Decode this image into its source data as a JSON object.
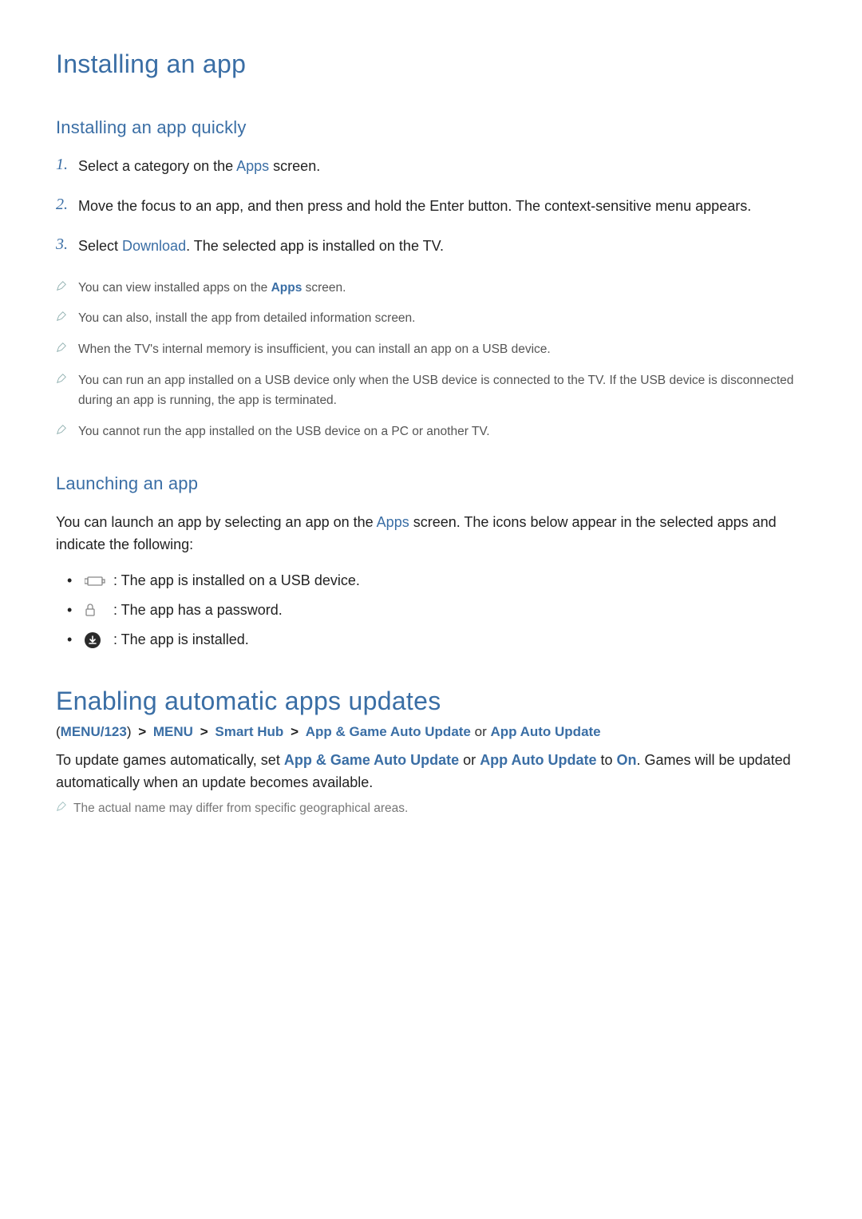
{
  "section1": {
    "title": "Installing an app",
    "sub1": {
      "heading": "Installing an app quickly",
      "steps": {
        "s1_num": "1.",
        "s1_a": "Select a category on the ",
        "s1_link": "Apps",
        "s1_b": " screen.",
        "s2_num": "2.",
        "s2": "Move the focus to an app, and then press and hold the Enter button. The context-sensitive menu appears.",
        "s3_num": "3.",
        "s3_a": "Select ",
        "s3_link": "Download",
        "s3_b": ". The selected app is installed on the TV."
      },
      "notes": {
        "n1_a": "You can view installed apps on the ",
        "n1_link": "Apps",
        "n1_b": " screen.",
        "n2": "You can also, install the app from detailed information screen.",
        "n3": "When the TV's internal memory is insufficient, you can install an app on a USB device.",
        "n4": "You can run an app installed on a USB device only when the USB device is connected to the TV. If the USB device is disconnected during an app is running, the app is terminated.",
        "n5": "You cannot run the app installed on the USB device on a PC or another TV."
      }
    },
    "sub2": {
      "heading": "Launching an app",
      "intro_a": "You can launch an app by selecting an app on the ",
      "intro_link": "Apps",
      "intro_b": " screen. The icons below appear in the selected apps and indicate the following:",
      "bullets": {
        "b1": " : The app is installed on a USB device.",
        "b2": " : The app has a password.",
        "b3": " : The app is installed."
      }
    }
  },
  "section2": {
    "title": "Enabling automatic apps updates",
    "crumb": {
      "paren_open": "(",
      "c1": "MENU/123",
      "paren_close": ")",
      "c2": "MENU",
      "c3": "Smart Hub",
      "c4": "App & Game Auto Update",
      "or": " or ",
      "c5": "App Auto Update",
      "gt": ">"
    },
    "body_a": "To update games automatically, set ",
    "body_link1": "App & Game Auto Update",
    "body_mid": " or ",
    "body_link2": "App Auto Update",
    "body_to": " to ",
    "body_link3": "On",
    "body_b": ". Games will be updated automatically when an update becomes available.",
    "note": "The actual name may differ from specific geographical areas."
  }
}
